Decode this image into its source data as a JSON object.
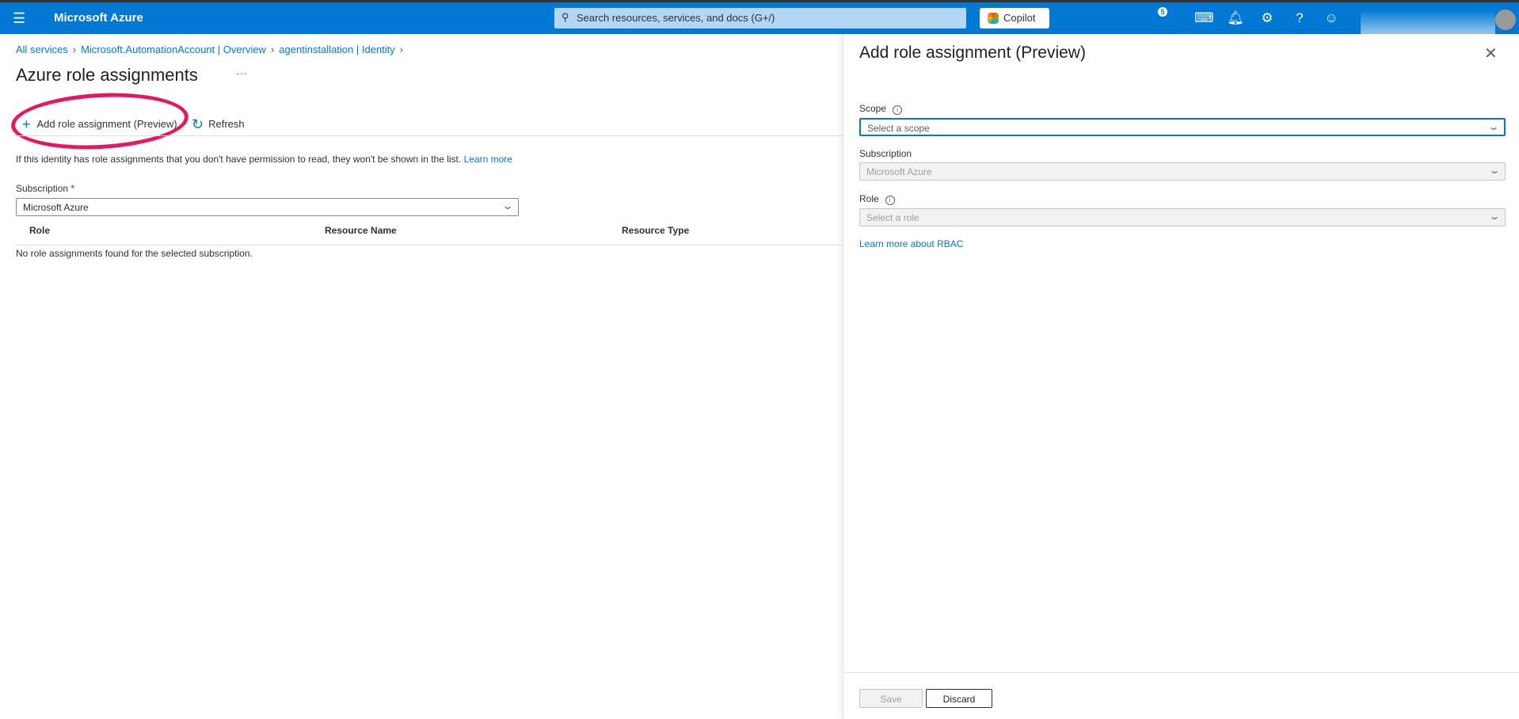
{
  "header": {
    "brand": "Microsoft Azure",
    "search_placeholder": "Search resources, services, and docs (G+/)",
    "copilot_label": "Copilot",
    "notification_count": "5",
    "accent": "#0078d4"
  },
  "breadcrumb": [
    "All services",
    "Microsoft.AutomationAccount | Overview",
    "agentinstallation | Identity"
  ],
  "page": {
    "title": "Azure role assignments",
    "more": "···"
  },
  "toolbar": {
    "add_label": "Add role assignment (Preview)",
    "refresh_label": "Refresh",
    "highlight_color": "#e8175d"
  },
  "info": {
    "text": "If this identity has role assignments that you don't have permission to read, they won't be shown in the list.",
    "link": "Learn more"
  },
  "subscription": {
    "label": "Subscription",
    "required": "*",
    "value": "Microsoft Azure"
  },
  "table": {
    "columns": [
      "Role",
      "Resource Name",
      "Resource Type"
    ],
    "empty": "No role assignments found for the selected subscription."
  },
  "panel": {
    "title": "Add role assignment (Preview)",
    "scope": {
      "label": "Scope",
      "placeholder": "Select a scope"
    },
    "subscription": {
      "label": "Subscription",
      "value": "Microsoft Azure"
    },
    "role": {
      "label": "Role",
      "placeholder": "Select a role"
    },
    "rbac_link": "Learn more about RBAC",
    "save_label": "Save",
    "discard_label": "Discard"
  }
}
